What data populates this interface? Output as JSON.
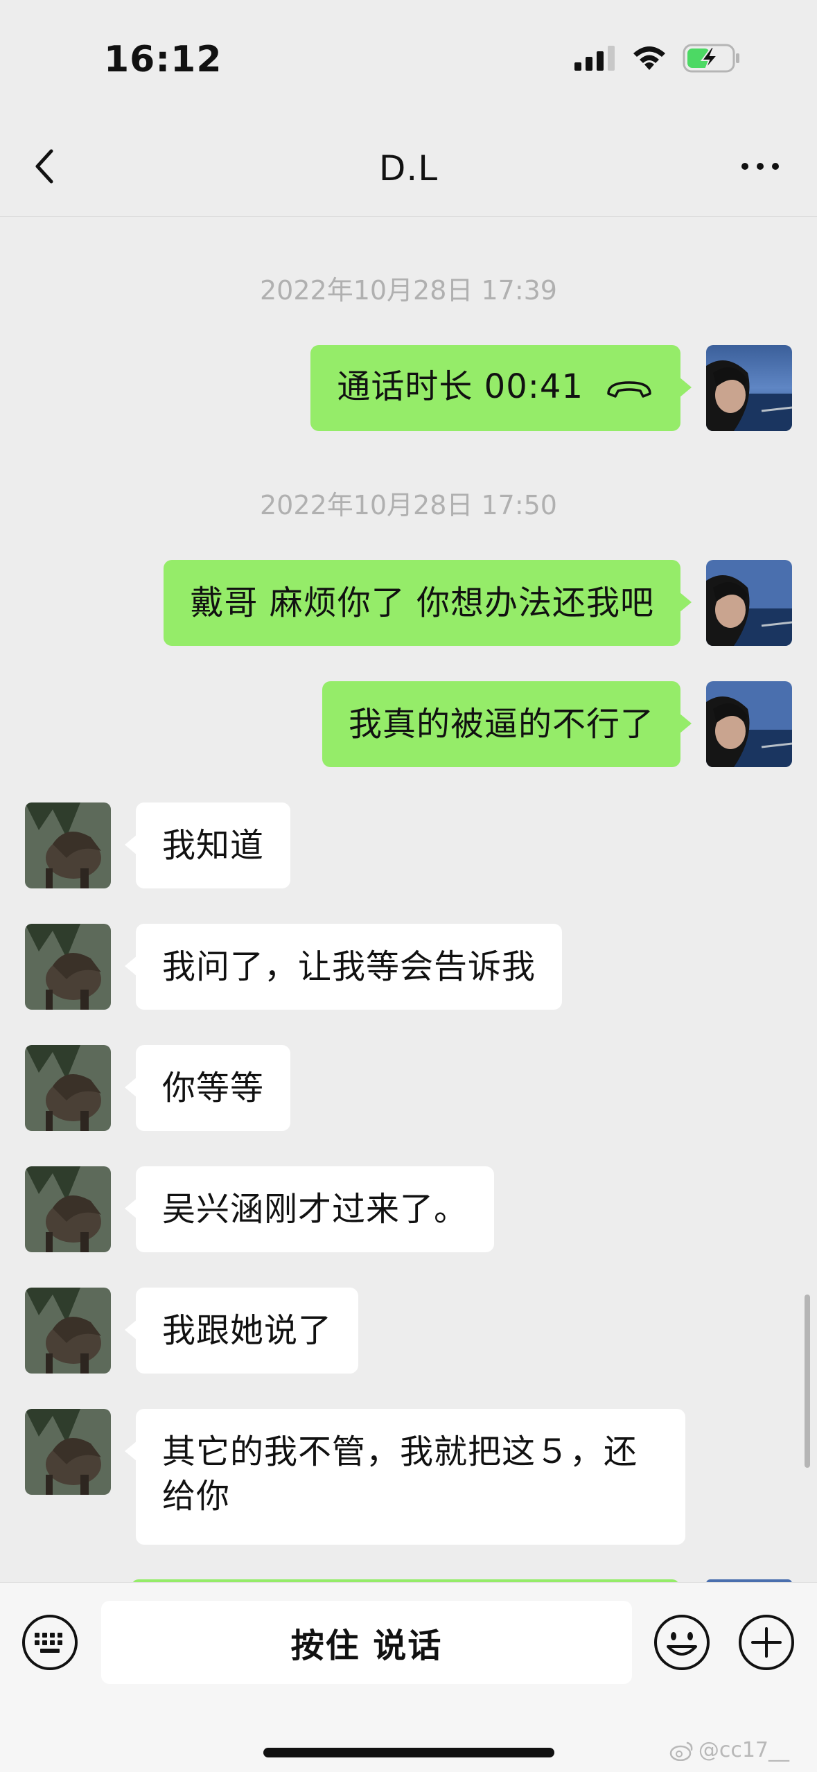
{
  "status_bar": {
    "time": "16:12"
  },
  "nav": {
    "title": "D.L"
  },
  "messages": {
    "ts1": "2022年10月28日 17:39",
    "call_text": "通话时长 00:41",
    "ts2": "2022年10月28日 17:50",
    "m1": "戴哥 麻烦你了 你想办法还我吧",
    "m2": "我真的被逼的不行了",
    "m3": "我知道",
    "m4": "我问了，让我等会告诉我",
    "m5": "你等等",
    "m6": "吴兴涵刚才过来了。",
    "m7": "我跟她说了",
    "m8": "其它的我不管，我就把这５，还给你"
  },
  "input_bar": {
    "voice_label": "按住 说话"
  },
  "watermark": {
    "text": "@cc17__"
  },
  "colors": {
    "background": "#ededed",
    "sent_bubble": "#95ec69",
    "received_bubble": "#ffffff",
    "timestamp": "#b0b0b0",
    "battery_charge": "#4cd964"
  },
  "icons": [
    "signal-icon",
    "wifi-icon",
    "battery-charging-icon",
    "back-chevron-icon",
    "more-icon",
    "phone-hangup-icon",
    "keyboard-icon",
    "emoji-icon",
    "plus-icon"
  ]
}
